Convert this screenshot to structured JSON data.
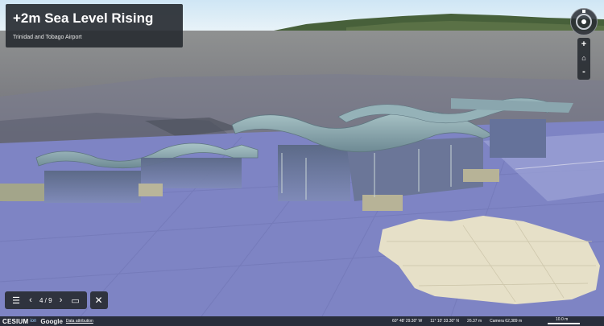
{
  "story": {
    "title": "+2m Sea Level Rising",
    "subtitle": "Trinidad and Tobago Airport"
  },
  "navigation": {
    "zoom_in": "+",
    "zoom_out": "-",
    "home_icon": "home-icon",
    "compass_icon": "compass-icon"
  },
  "toolbar": {
    "list_icon": "list-icon",
    "prev_icon": "chevron-left-icon",
    "counter": "4 / 9",
    "next_icon": "chevron-right-icon",
    "present_icon": "monitor-icon",
    "tools_icon": "tools-icon"
  },
  "footer": {
    "brand": "CESIUM",
    "brand_suffix": "ion",
    "google": "Google",
    "attribution": "Data attribution",
    "latitude": "60° 48' 29.30\" W",
    "longitude": "11° 10' 33.30\" N",
    "elevation": "26.37 m",
    "camera": "Camera 62,389 m",
    "scale": "10.0 m"
  },
  "colors": {
    "flood_water": "#7e84c4",
    "panel_bg": "#282c32"
  }
}
